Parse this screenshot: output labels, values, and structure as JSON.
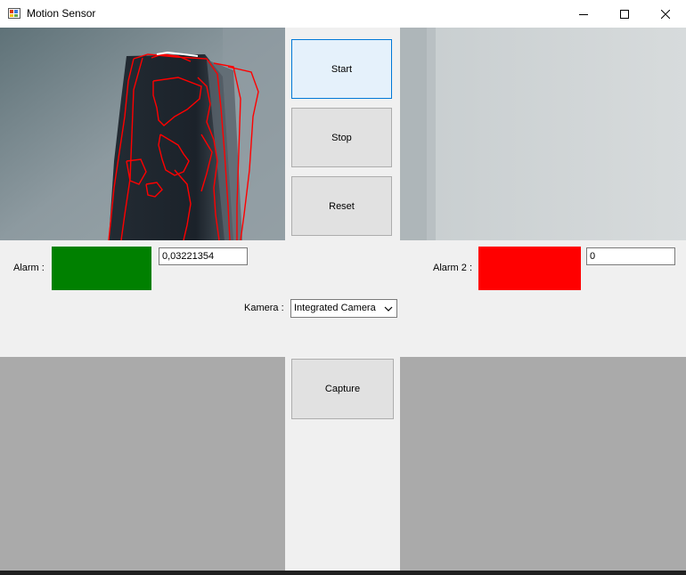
{
  "window": {
    "title": "Motion Sensor",
    "controls": [
      "minimize-icon",
      "maximize-icon",
      "close-icon"
    ]
  },
  "buttons": {
    "start": "Start",
    "stop": "Stop",
    "reset": "Reset",
    "capture": "Capture"
  },
  "alarm1": {
    "label": "Alarm :",
    "color": "#008000",
    "value": "0,03221354"
  },
  "alarm2": {
    "label": "Alarm 2 :",
    "color": "#ff0000",
    "value": "0"
  },
  "camera": {
    "label": "Kamera :",
    "selected": "Integrated Camera"
  },
  "colors": {
    "window_bg": "#f0f0f0",
    "capture_panel": "#aaaaaa",
    "motion_outline": "#ff0000"
  }
}
